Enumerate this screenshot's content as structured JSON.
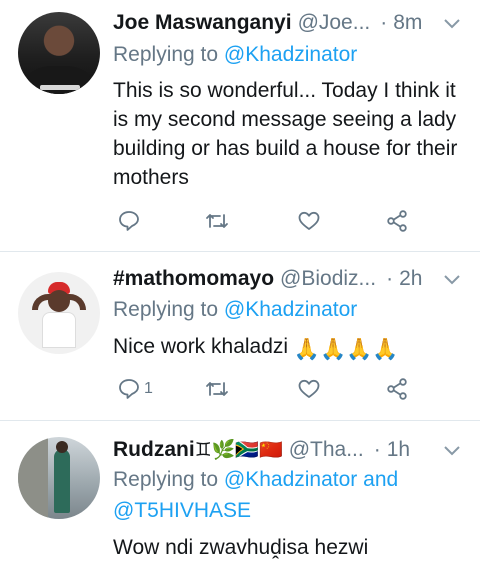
{
  "tweets": [
    {
      "name": "Joe Maswanganyi",
      "handle": "@Joe...",
      "dot": "·",
      "time": "8m",
      "reply_prefix": "Replying to",
      "reply_to": "@Khadzinator",
      "text": "This is so wonderful... Today I think it is my second message seeing a lady building or has build a house for their mothers",
      "reply_count": ""
    },
    {
      "name": "#mathomomayo",
      "handle": "@Biodiz...",
      "dot": "·",
      "time": "2h",
      "reply_prefix": "Replying to",
      "reply_to": "@Khadzinator",
      "text": "Nice work khaladzi",
      "text_emoji": "🙏🙏🙏🙏",
      "reply_count": "1"
    },
    {
      "name": "Rudzani",
      "name_emoji": "♊🌿🇿🇦🇨🇳",
      "handle": "@Tha...",
      "dot": "·",
      "time": "1h",
      "reply_prefix": "Replying to",
      "reply_to": "@Khadzinator and",
      "reply_to_2": "@T5HIVHASE",
      "text": "Wow ndi zwavhuḓisa hezwi"
    }
  ],
  "icons": [
    "reply-icon",
    "retweet-icon",
    "like-icon",
    "share-icon",
    "caret-down-icon"
  ],
  "colors": {
    "link": "#1da1f2",
    "secondary": "#657786",
    "text": "#14171a",
    "divider": "#e1e8ed"
  }
}
